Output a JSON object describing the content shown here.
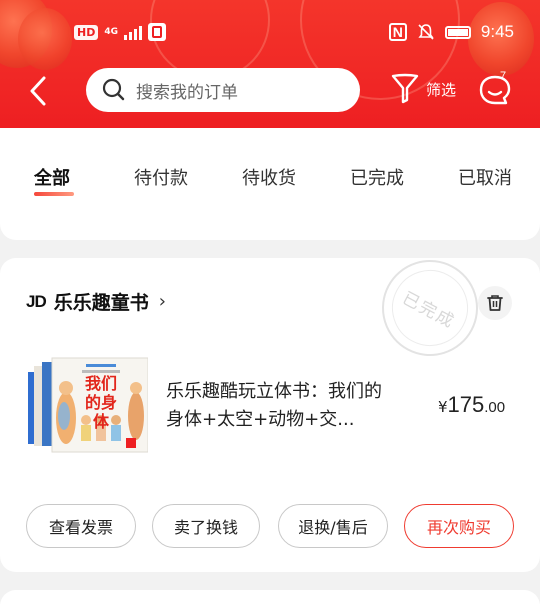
{
  "status_bar": {
    "left_badges": [
      "HD",
      "4G"
    ],
    "time": "9:45",
    "nfc": "N"
  },
  "header": {
    "search_placeholder": "搜索我的订单",
    "filter_label": "筛选",
    "message_count": "7"
  },
  "tabs": [
    {
      "label": "全部",
      "active": true
    },
    {
      "label": "待付款",
      "active": false
    },
    {
      "label": "待收货",
      "active": false
    },
    {
      "label": "已完成",
      "active": false
    },
    {
      "label": "已取消",
      "active": false
    }
  ],
  "order": {
    "shop_logo": "JD",
    "shop_name": "乐乐趣童书",
    "shop_arrow": "›",
    "status_stamp": "已完成",
    "product": {
      "title": "乐乐趣酷玩立体书：我们的身体+太空+动物+交...",
      "cover_text": "我们的身体",
      "price_symbol": "¥",
      "price_int": "175",
      "price_dec": ".00"
    },
    "actions": [
      {
        "label": "查看发票",
        "primary": false
      },
      {
        "label": "卖了换钱",
        "primary": false
      },
      {
        "label": "退换/售后",
        "primary": false
      },
      {
        "label": "再次购买",
        "primary": true
      }
    ]
  },
  "icons": {
    "back": "back-arrow-icon",
    "search": "search-icon",
    "filter": "filter-funnel-icon",
    "message": "message-bubble-icon",
    "trash": "trash-icon"
  },
  "colors": {
    "brand_red": "#ee1f22",
    "accent_red": "#ef3b30"
  }
}
